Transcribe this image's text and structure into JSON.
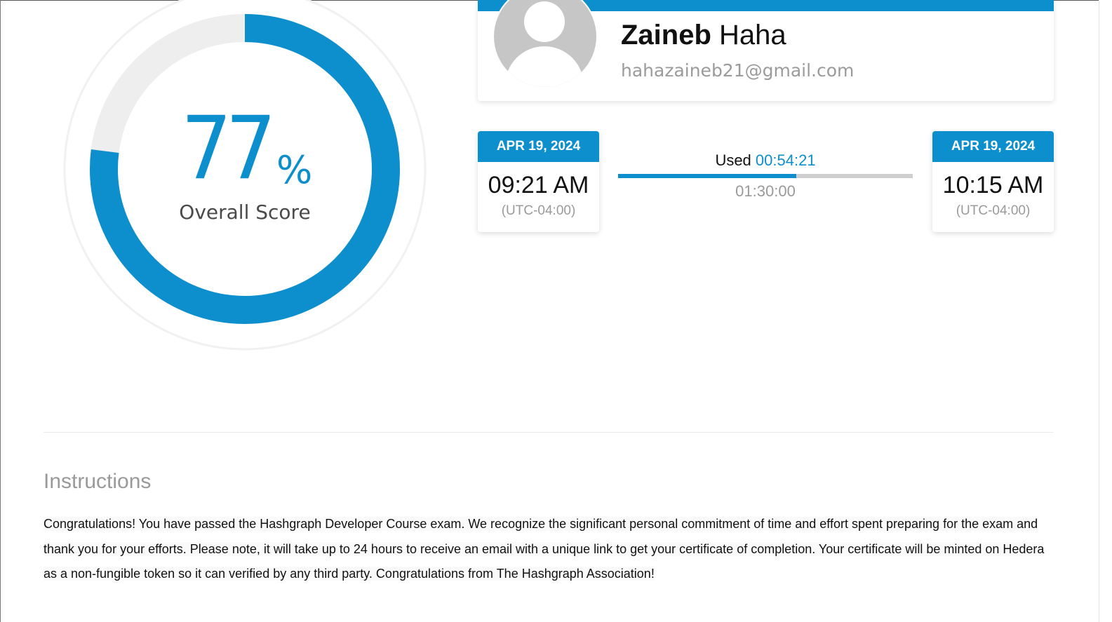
{
  "score": {
    "value": "77",
    "unit": "%",
    "label": "Overall Score",
    "fraction": 0.77,
    "colors": {
      "fill": "#0d8fce",
      "track": "#eeeeee"
    }
  },
  "profile": {
    "first_name": "Zaineb",
    "last_name": "Haha",
    "email": "hahazaineb21@gmail.com",
    "avatar_icon": "default-user-avatar-icon"
  },
  "exam_time": {
    "start": {
      "date": "APR 19, 2024",
      "time": "09:21 AM",
      "timezone": "(UTC-04:00)"
    },
    "end": {
      "date": "APR 19, 2024",
      "time": "10:15 AM",
      "timezone": "(UTC-04:00)"
    },
    "used_label": "Used",
    "used_value": "00:54:21",
    "total": "01:30:00",
    "used_fraction": 0.604
  },
  "instructions": {
    "title": "Instructions",
    "text": "Congratulations! You have passed the Hashgraph Developer Course exam. We recognize the significant personal commitment of time and effort spent preparing for the exam and thank you for your efforts. Please note, it will take up to 24 hours to receive an email with a unique link to get your certificate of completion. Your certificate will be minted on Hedera as a non-fungible token so it can verified by any third party. Congratulations from The Hashgraph Association!"
  },
  "theme": {
    "accent": "#0d8fce"
  }
}
